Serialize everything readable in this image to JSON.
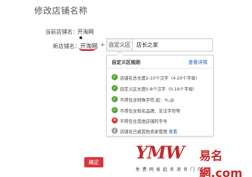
{
  "page": {
    "title": "修改店铺名称"
  },
  "current": {
    "label": "当前店铺名：",
    "value": "开淘网"
  },
  "new_name": {
    "label": "新店铺名：",
    "fixed_part": "开淘网",
    "plus": "+",
    "addon_label": "自定义区",
    "input_value": "店长之家"
  },
  "rules_popover": {
    "title": "自定义区规则",
    "details_link": "查看详情",
    "rules": [
      {
        "status": "ok",
        "icon": "check-icon",
        "text": "店铺名总长度2-10个汉字（4-20个字母）"
      },
      {
        "status": "ok",
        "icon": "check-icon",
        "text": "自定义区长度0-8个汉字（0-16个字母）"
      },
      {
        "status": "ok",
        "icon": "check-icon",
        "text": "不得包含特殊字符,如：%,@"
      },
      {
        "status": "ok",
        "icon": "check-icon",
        "text": "不得包含知名品牌、非法字符等"
      },
      {
        "status": "error",
        "icon": "cross-icon",
        "text": "不得包含其他店铺的字号"
      },
      {
        "status": "info",
        "icon": "info-icon",
        "text": "店铺名已被其他卖家使用",
        "link": "查看"
      }
    ]
  },
  "actions": {
    "confirm_label": "确定"
  },
  "watermark": {
    "latin": "YMW",
    "chinese": "易名網",
    "domain": ".com",
    "tagline": "免费网易起名测名门户"
  },
  "colors": {
    "accent_red": "#d9363e",
    "ok_green": "#55a532",
    "link_blue": "#1a5fb4"
  }
}
